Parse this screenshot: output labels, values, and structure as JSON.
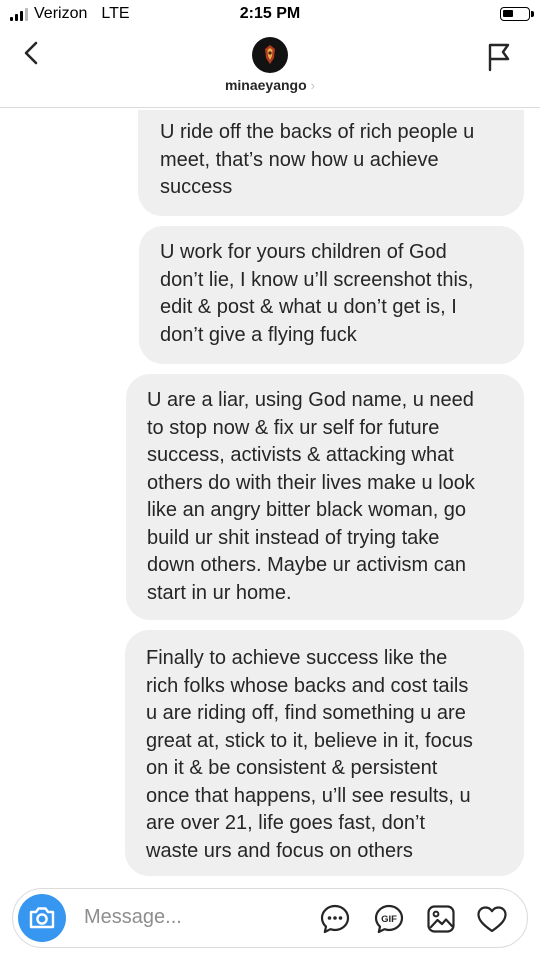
{
  "status_bar": {
    "carrier": "Verizon",
    "network": "LTE",
    "time": "2:15 PM",
    "battery_level": 0.45
  },
  "header": {
    "username": "minaeyango",
    "username_chevron": "›",
    "back_icon": "chevron-left-icon",
    "report_icon": "flag-icon"
  },
  "messages": [
    {
      "text": "U ride off the backs of rich people u\nmeet, that’s now how u achieve\nsuccess"
    },
    {
      "text": "U work for yours children of God\ndon’t lie, I know u’ll screenshot this,\nedit & post & what u don’t get is, I\ndon’t give a flying fuck"
    },
    {
      "text": "U are a liar, using God name, u need\nto stop now & fix ur self for future\nsuccess, activists & attacking what\nothers do with their lives make u look\nlike an angry bitter black woman, go\nbuild ur shit instead of trying take\ndown others. Maybe ur activism can\nstart in ur home."
    },
    {
      "text": "Finally to achieve success like the\nrich folks whose backs and cost tails\nu are riding off, find something u are\ngreat at, stick to it, believe in it, focus\non it & be consistent & persistent\nonce that happens, u’ll see results, u\nare over 21, life goes fast, don’t\nwaste urs and focus on others"
    }
  ],
  "composer": {
    "placeholder": "Message...",
    "gif_label": "GIF",
    "icons": [
      "camera-icon",
      "chat-bubble-icon",
      "gif-icon",
      "image-icon",
      "heart-icon"
    ]
  },
  "colors": {
    "bubble_bg": "#efefef",
    "accent": "#3797f0",
    "text": "#262626",
    "placeholder": "#8e8e8e",
    "divider": "#dbdbdb"
  }
}
